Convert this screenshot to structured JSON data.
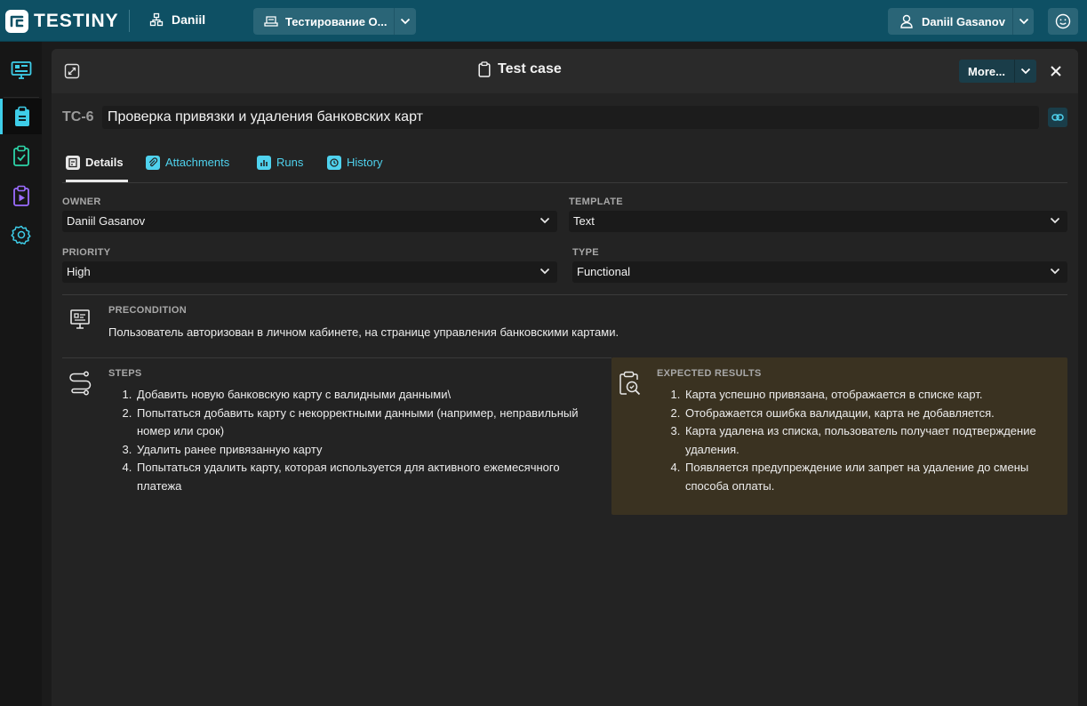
{
  "app": {
    "brand": "TESTINY"
  },
  "topbar": {
    "org": "Daniil",
    "project": "Тестирование О...",
    "user": "Daniil Gasanov"
  },
  "panel": {
    "title": "Test case",
    "more_label": "More..."
  },
  "test_case": {
    "key": "TC-6",
    "title": "Проверка привязки и удаления банковских карт"
  },
  "tabs": [
    {
      "label": "Details"
    },
    {
      "label": "Attachments"
    },
    {
      "label": "Runs"
    },
    {
      "label": "History"
    }
  ],
  "fields": {
    "owner": {
      "label": "OWNER",
      "value": "Daniil Gasanov"
    },
    "template": {
      "label": "TEMPLATE",
      "value": "Text"
    },
    "priority": {
      "label": "PRIORITY",
      "value": "High"
    },
    "type": {
      "label": "TYPE",
      "value": "Functional"
    }
  },
  "precondition": {
    "label": "PRECONDITION",
    "text": "Пользователь авторизован в личном кабинете, на странице управления банковскими картами."
  },
  "steps": {
    "label": "STEPS",
    "items": [
      "Добавить новую банковскую карту с валидными данными\\",
      " Попытаться добавить карту с некорректными данными (например, неправильный номер или срок)",
      "Удалить ранее привязанную карту",
      "Попытаться удалить карту, которая используется для активного ежемесячного платежа"
    ]
  },
  "expected": {
    "label": "EXPECTED RESULTS",
    "items": [
      "Карта успешно привязана, отображается в списке карт.",
      "Отображается ошибка валидации, карта не добавляется.",
      "Карта удалена из списка, пользователь получает подтверждение удаления.",
      "Появляется предупреждение или запрет на удаление до смены способа оплаты."
    ]
  },
  "colors": {
    "topbar": "#0e5064",
    "accent": "#4fd2ee",
    "expected_bg": "#3a3221"
  },
  "icons": {
    "rail": [
      "monitor-icon",
      "clipboard-icon",
      "clipboard-check-icon",
      "clipboard-play-icon",
      "gear-icon"
    ]
  }
}
